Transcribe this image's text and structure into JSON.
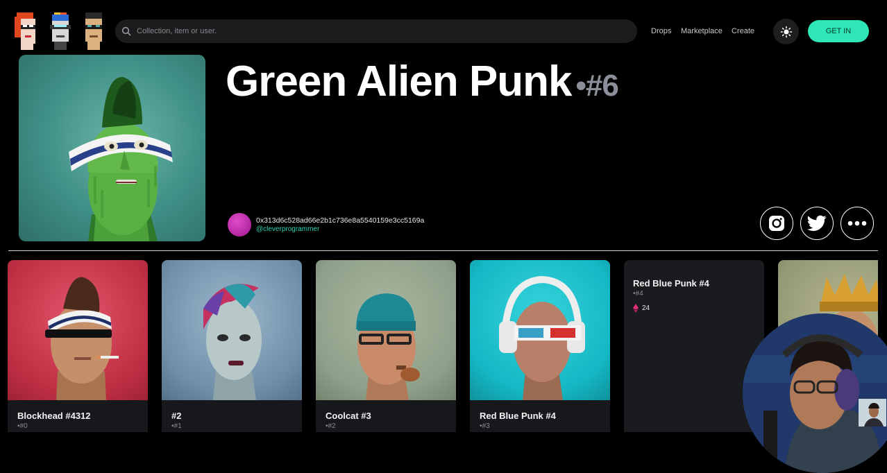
{
  "header": {
    "search_placeholder": "Collection, item or user.",
    "nav": [
      "Drops",
      "Marketplace",
      "Create"
    ],
    "cta_label": "GET IN",
    "accent_color": "#2ee6b6"
  },
  "hero": {
    "title": "Green Alien Punk",
    "number": "•#6",
    "owner_address": "0x313d6c528ad66e2b1c736e8a5540159e3cc5169a",
    "owner_handle": "@cleverprogrammer",
    "social_icons": [
      "instagram-icon",
      "twitter-icon",
      "more-icon"
    ]
  },
  "cards": [
    {
      "name": "Blockhead #4312",
      "id": "•#0",
      "bg": "#c8344a"
    },
    {
      "name": "#2",
      "id": "•#1",
      "bg": "#6f8fa8"
    },
    {
      "name": "Coolcat #3",
      "id": "•#2",
      "bg": "#8fa08a"
    },
    {
      "name": "Red Blue Punk #4",
      "id": "•#3",
      "bg": "#14b7c4"
    },
    {
      "name": "Red Blue Punk #4",
      "id": "•#4",
      "price": "24"
    }
  ]
}
